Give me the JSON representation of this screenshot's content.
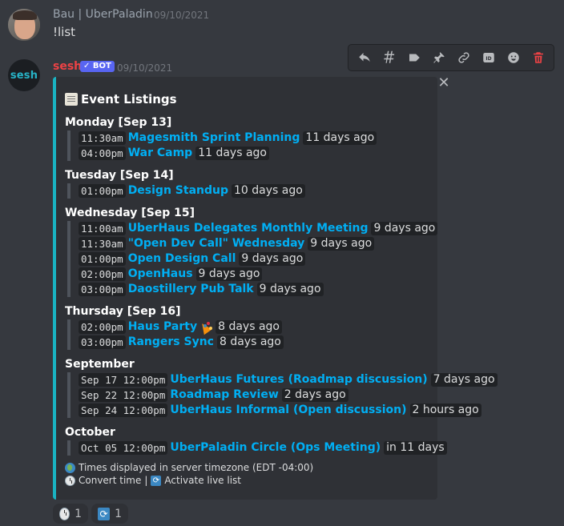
{
  "messages": {
    "bau": {
      "username": "Bau | UberPaladin",
      "timestamp": "09/10/2021",
      "text": "!list"
    },
    "sesh": {
      "username": "sesh",
      "bot_tag": "✓ BOT",
      "timestamp": "09/10/2021",
      "avatar_text": "sesh"
    }
  },
  "toolbar": {
    "icons": [
      "reply-icon",
      "thread-icon",
      "tag-icon",
      "pin-icon",
      "link-icon",
      "id-icon",
      "emoji-icon",
      "delete-icon"
    ]
  },
  "embed": {
    "title": "Event Listings",
    "accent_color": "#1ab3c2",
    "sections": [
      {
        "title": "Monday [Sep 13]",
        "events": [
          {
            "time": "11:30am",
            "name": "Magesmith Sprint Planning",
            "relative": "11 days ago"
          },
          {
            "time": "04:00pm",
            "name": "War Camp",
            "relative": "11 days ago"
          }
        ]
      },
      {
        "title": "Tuesday [Sep 14]",
        "events": [
          {
            "time": "01:00pm",
            "name": "Design Standup",
            "relative": "10 days ago"
          }
        ]
      },
      {
        "title": "Wednesday [Sep 15]",
        "events": [
          {
            "time": "11:00am",
            "name": "UberHaus Delegates Monthly Meeting",
            "relative": "9 days ago"
          },
          {
            "time": "11:30am",
            "name": "\"Open Dev Call\" Wednesday",
            "relative": "9 days ago"
          },
          {
            "time": "01:00pm",
            "name": "Open Design Call",
            "relative": "9 days ago"
          },
          {
            "time": "02:00pm",
            "name": "OpenHaus",
            "relative": "9 days ago"
          },
          {
            "time": "03:00pm",
            "name": "Daostillery Pub Talk",
            "relative": "9 days ago"
          }
        ]
      },
      {
        "title": "Thursday [Sep 16]",
        "events": [
          {
            "time": "02:00pm",
            "name": "Haus Party",
            "relative": "8 days ago",
            "emoji": "party-popper-icon"
          },
          {
            "time": "03:00pm",
            "name": "Rangers Sync",
            "relative": "8 days ago"
          }
        ]
      },
      {
        "title": "September",
        "events": [
          {
            "time": "Sep 17 12:00pm",
            "name": "UberHaus Futures (Roadmap discussion)",
            "relative": "7 days ago"
          },
          {
            "time": "Sep 22 12:00pm",
            "name": "Roadmap Review",
            "relative": "2 days ago"
          },
          {
            "time": "Sep 24 12:00pm",
            "name": "UberHaus Informal (Open discussion)",
            "relative": "2 hours ago"
          }
        ]
      },
      {
        "title": "October",
        "events": [
          {
            "time": "Oct 05 12:00pm",
            "name": "UberPaladin Circle (Ops Meeting)",
            "relative": "in 11 days"
          }
        ]
      }
    ],
    "footer": {
      "timezone": "Times displayed in server timezone (EDT -04:00)",
      "convert": "Convert time",
      "separator": "|",
      "activate": "Activate live list"
    }
  },
  "reactions": [
    {
      "icon": "clock-icon",
      "count": "1"
    },
    {
      "icon": "refresh-icon",
      "count": "1"
    }
  ]
}
